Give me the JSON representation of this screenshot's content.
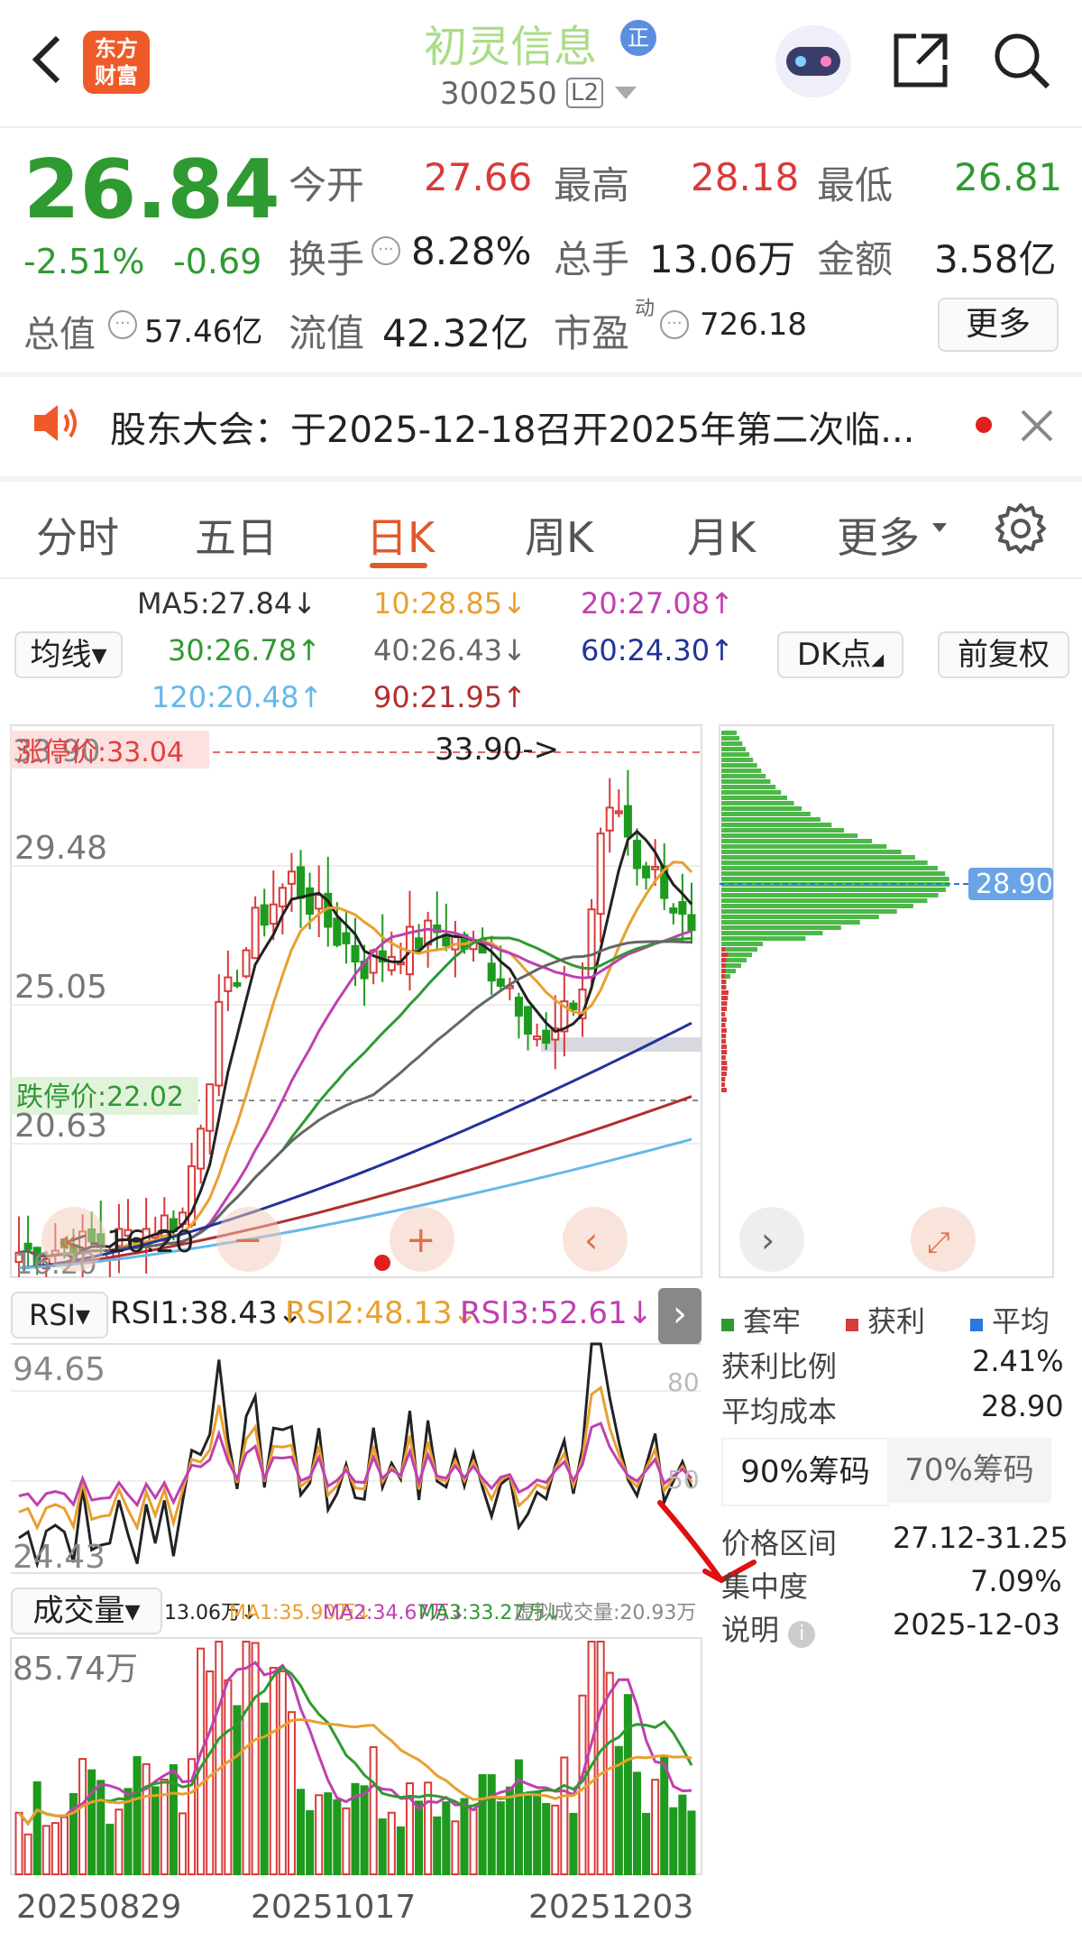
{
  "header": {
    "app_logo_text_1": "东方",
    "app_logo_text_2": "财富",
    "stock_name": "初灵信息",
    "stock_badge": "正",
    "stock_code": "300250",
    "level_badge": "L2"
  },
  "quote": {
    "price": "26.84",
    "change_pct": "-2.51%",
    "change_abs": "-0.69",
    "fields": [
      {
        "label": "今开",
        "value": "27.66"
      },
      {
        "label": "最高",
        "value": "28.18"
      },
      {
        "label": "最低",
        "value": "26.81"
      },
      {
        "label": "换手",
        "value": "8.28%"
      },
      {
        "label": "总手",
        "value": "13.06万"
      },
      {
        "label": "金额",
        "value": "3.58亿"
      },
      {
        "label": "总值",
        "value": "57.46亿"
      },
      {
        "label": "流值",
        "value": "42.32亿"
      },
      {
        "label": "市盈",
        "value": "726.18"
      }
    ],
    "pe_superscript": "动",
    "more_button": "更多"
  },
  "notice": {
    "text": "股东大会：于2025-12-18召开2025年第二次临..."
  },
  "tabs": [
    "分时",
    "五日",
    "日K",
    "周K",
    "月K",
    "更多"
  ],
  "active_tab": "日K",
  "ma_panel": {
    "selector": "均线",
    "dk_button": "DK点",
    "fq_button": "前复权",
    "items": [
      {
        "label": "MA5:27.84↓",
        "color": "#333333"
      },
      {
        "label": "10:28.85↓",
        "color": "#e8a030"
      },
      {
        "label": "20:27.08↑",
        "color": "#c040b0"
      },
      {
        "label": "30:26.78↑",
        "color": "#2f9a31"
      },
      {
        "label": "40:26.43↓",
        "color": "#666666"
      },
      {
        "label": "60:24.30↑",
        "color": "#223399"
      },
      {
        "label": "120:20.48↑",
        "color": "#66b8e8"
      },
      {
        "label": "90:21.95↑",
        "color": "#b03030"
      }
    ]
  },
  "kline": {
    "y_labels": [
      "33.90",
      "29.48",
      "25.05",
      "20.63",
      "16.20"
    ],
    "limit_up": "涨停价:33.04",
    "limit_down": "跌停价:22.02",
    "high_marker": "33.90->",
    "low_marker": "16.20",
    "low_marker_prefix": "<-",
    "colors": {
      "up": "#d93a3a",
      "down": "#1e9a1e"
    }
  },
  "chip": {
    "price_tag": "28.90",
    "legend": [
      {
        "label": "套牢",
        "color": "#2f9a31"
      },
      {
        "label": "获利",
        "color": "#d93a3a"
      },
      {
        "label": "平均",
        "color": "#2a78e0"
      }
    ],
    "rows": [
      {
        "label": "获利比例",
        "value": "2.41%"
      },
      {
        "label": "平均成本",
        "value": "28.90"
      }
    ],
    "tabs": [
      "90%筹码",
      "70%筹码"
    ],
    "detail_rows": [
      {
        "label": "价格区间",
        "value": "27.12-31.25"
      },
      {
        "label": "集中度",
        "value": "7.09%"
      },
      {
        "label": "说明",
        "value": "2025-12-03"
      }
    ]
  },
  "rsi": {
    "selector": "RSI",
    "rsi1": "RSI1:38.43↓",
    "rsi2": "RSI2:48.13↓",
    "rsi3": "RSI3:52.61↓",
    "y_labels": [
      "94.65",
      "24.43"
    ],
    "ref_labels": [
      "80",
      "50"
    ]
  },
  "volume": {
    "selector": "成交量",
    "vol": "13.06万↓",
    "ma1": "MA1:35.90万↓",
    "ma2": "MA2:34.67万↓",
    "ma3": "MA3:33.27万↓",
    "virtual": "虚拟成交量:20.93万",
    "y_label": "85.74万"
  },
  "x_axis": [
    "20250829",
    "20251017",
    "20251203"
  ],
  "chart_data": {
    "type": "candlestick",
    "title": "初灵信息 300250 日K",
    "ylim": [
      16.2,
      33.9
    ],
    "ma_lines": {
      "MA5": 27.84,
      "MA10": 28.85,
      "MA20": 27.08,
      "MA30": 26.78,
      "MA40": 26.43,
      "MA60": 24.3,
      "MA90": 21.95,
      "MA120": 20.48
    },
    "rsi": {
      "RSI1": 38.43,
      "RSI2": 48.13,
      "RSI3": 52.61,
      "ylim": [
        24.43,
        94.65
      ]
    },
    "volume": {
      "latest": "13.06万",
      "MA1": "35.90万",
      "MA2": "34.67万",
      "MA3": "33.27万",
      "max": "85.74万"
    },
    "x_ticks": [
      "20250829",
      "20251017",
      "20251203"
    ]
  }
}
